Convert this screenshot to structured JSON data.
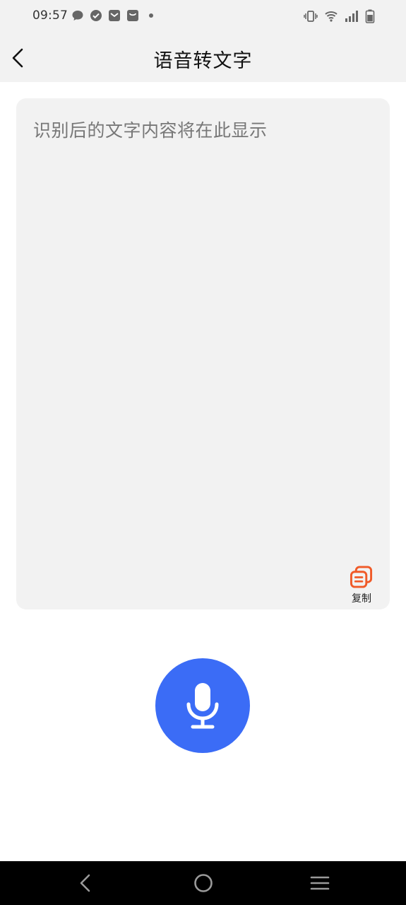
{
  "status_bar": {
    "time": "09:57",
    "left_icons": [
      "chat-bubble-icon",
      "check-circle-icon",
      "mail-icon",
      "shopping-bag-icon",
      "dot-icon"
    ],
    "right_icons": [
      "vibrate-icon",
      "wifi-icon",
      "signal-icon",
      "battery-icon"
    ]
  },
  "header": {
    "title": "语音转文字",
    "back_icon": "chevron-left-icon"
  },
  "text_area": {
    "placeholder": "识别后的文字内容将在此显示",
    "copy_label": "复制",
    "copy_icon": "copy-icon"
  },
  "mic": {
    "icon": "microphone-icon"
  },
  "nav_bar": {
    "items": [
      "nav-back-icon",
      "nav-home-icon",
      "nav-menu-icon"
    ]
  },
  "colors": {
    "accent": "#3b6cf6",
    "copy_icon": "#f05a28",
    "background_gray": "#f2f2f2"
  }
}
